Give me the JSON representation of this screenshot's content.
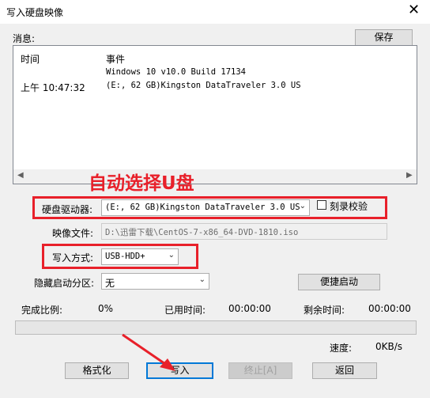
{
  "window": {
    "title": "写入硬盘映像",
    "close_glyph": "✕"
  },
  "messages": {
    "label": "消息:",
    "save_label": "保存",
    "col_time": "时间",
    "col_event": "事件",
    "rows": [
      {
        "time": "",
        "event": "Windows 10 v10.0 Build 17134"
      },
      {
        "time": "上午 10:47:32",
        "event": "(E:, 62 GB)Kingston DataTraveler 3.0 US"
      }
    ]
  },
  "annotation": {
    "text": "自动选择U盘",
    "color": "#e8202a"
  },
  "drive": {
    "label": "硬盘驱动器:",
    "value": "(E:, 62 GB)Kingston DataTraveler 3.0 US",
    "verify_label": "刻录校验",
    "verify_checked": false
  },
  "image_file": {
    "label": "映像文件:",
    "value": "D:\\迅雷下载\\CentOS-7-x86_64-DVD-1810.iso"
  },
  "write_method": {
    "label": "写入方式:",
    "value": "USB-HDD+"
  },
  "hidden_partition": {
    "label": "隐藏启动分区:",
    "value": "无"
  },
  "quick_boot_label": "便捷启动",
  "progress": {
    "ratio_label": "完成比例:",
    "ratio_value": "0%",
    "elapsed_label": "已用时间:",
    "elapsed_value": "00:00:00",
    "remaining_label": "剩余时间:",
    "remaining_value": "00:00:00",
    "fraction": 0,
    "speed_label": "速度:",
    "speed_value": "0KB/s"
  },
  "buttons": {
    "format": "格式化",
    "write": "写入",
    "stop": "终止[A]",
    "back": "返回"
  },
  "colors": {
    "highlight": "#e8202a",
    "focus": "#0078d7"
  }
}
